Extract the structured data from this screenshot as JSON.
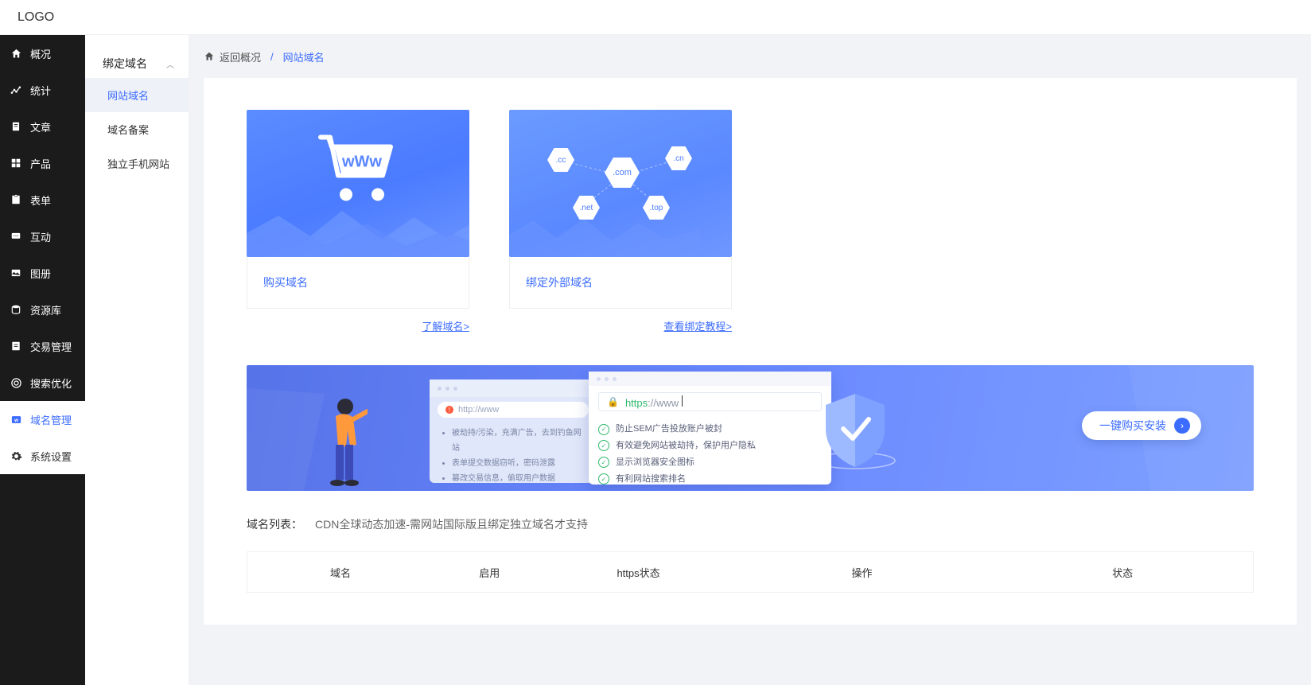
{
  "logo": "LOGO",
  "sidebar": {
    "items": [
      {
        "label": "概况",
        "icon": "home"
      },
      {
        "label": "统计",
        "icon": "chart"
      },
      {
        "label": "文章",
        "icon": "doc"
      },
      {
        "label": "产品",
        "icon": "grid"
      },
      {
        "label": "表单",
        "icon": "form"
      },
      {
        "label": "互动",
        "icon": "chat"
      },
      {
        "label": "图册",
        "icon": "image"
      },
      {
        "label": "资源库",
        "icon": "db"
      },
      {
        "label": "交易管理",
        "icon": "trade"
      },
      {
        "label": "搜索优化",
        "icon": "seo"
      },
      {
        "label": "域名管理",
        "icon": "domain"
      },
      {
        "label": "系统设置",
        "icon": "gear"
      }
    ]
  },
  "subnav": {
    "group": "绑定域名",
    "items": [
      "网站域名",
      "域名备案",
      "独立手机网站"
    ]
  },
  "breadcrumb": {
    "back": "返回概况",
    "current": "网站域名"
  },
  "cards": {
    "buy": {
      "title": "购买域名",
      "link": "了解域名>"
    },
    "bind": {
      "title": "绑定外部域名",
      "link": "查看绑定教程>",
      "tlds": [
        ".cc",
        ".com",
        ".cn",
        ".net",
        ".top"
      ]
    }
  },
  "banner": {
    "http_placeholder": "http://www",
    "http_bullets": [
      "被劫持/污染，充满广告，去到钓鱼网站",
      "表单提交数据窃听，密码泄露",
      "篡改交易信息，偷取用户数据"
    ],
    "https_prefix": "https",
    "https_rest": "://www ",
    "https_bullets": [
      "防止SEM广告投放账户被封",
      "有效避免网站被劫持，保护用户隐私",
      "显示浏览器安全图标",
      "有利网站搜索排名"
    ],
    "button": "一键购买安装"
  },
  "domain_list": {
    "title": "域名列表：",
    "note": "CDN全球动态加速-需网站国际版且绑定独立域名才支持",
    "columns": [
      "域名",
      "启用",
      "https状态",
      "操作",
      "状态"
    ]
  }
}
